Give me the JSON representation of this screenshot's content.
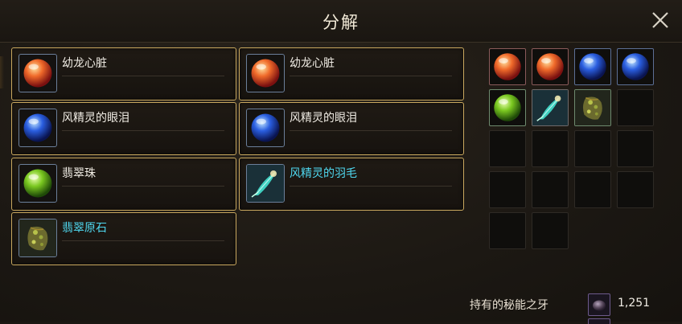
{
  "window": {
    "title": "分解",
    "close_icon": "close-icon"
  },
  "items": [
    {
      "name": "幼龙心脏",
      "icon": "red-orb-icon",
      "rare": false
    },
    {
      "name": "幼龙心脏",
      "icon": "red-orb-icon",
      "rare": false
    },
    {
      "name": "风精灵的眼泪",
      "icon": "blue-orb-icon",
      "rare": false
    },
    {
      "name": "风精灵的眼泪",
      "icon": "blue-orb-icon",
      "rare": false
    },
    {
      "name": "翡翠珠",
      "icon": "green-orb-icon",
      "rare": false
    },
    {
      "name": "风精灵的羽毛",
      "icon": "feather-icon",
      "rare": true
    },
    {
      "name": "翡翠原石",
      "icon": "emerald-ore-icon",
      "rare": true
    }
  ],
  "slots": [
    "red-orb-icon",
    "red-orb-icon",
    "blue-orb-icon",
    "blue-orb-icon",
    "green-orb-icon",
    "feather-icon",
    "emerald-ore-icon",
    "",
    "",
    "",
    "",
    "",
    "",
    "",
    "",
    "",
    "",
    ""
  ],
  "currency": {
    "label": "持有的秘能之牙",
    "amount": "1,251",
    "icon": "fang-stone-icon"
  },
  "colors": {
    "card_border": "#c9a85f",
    "rare_text": "#4fd8f0",
    "normal_text": "#f0ece4"
  }
}
